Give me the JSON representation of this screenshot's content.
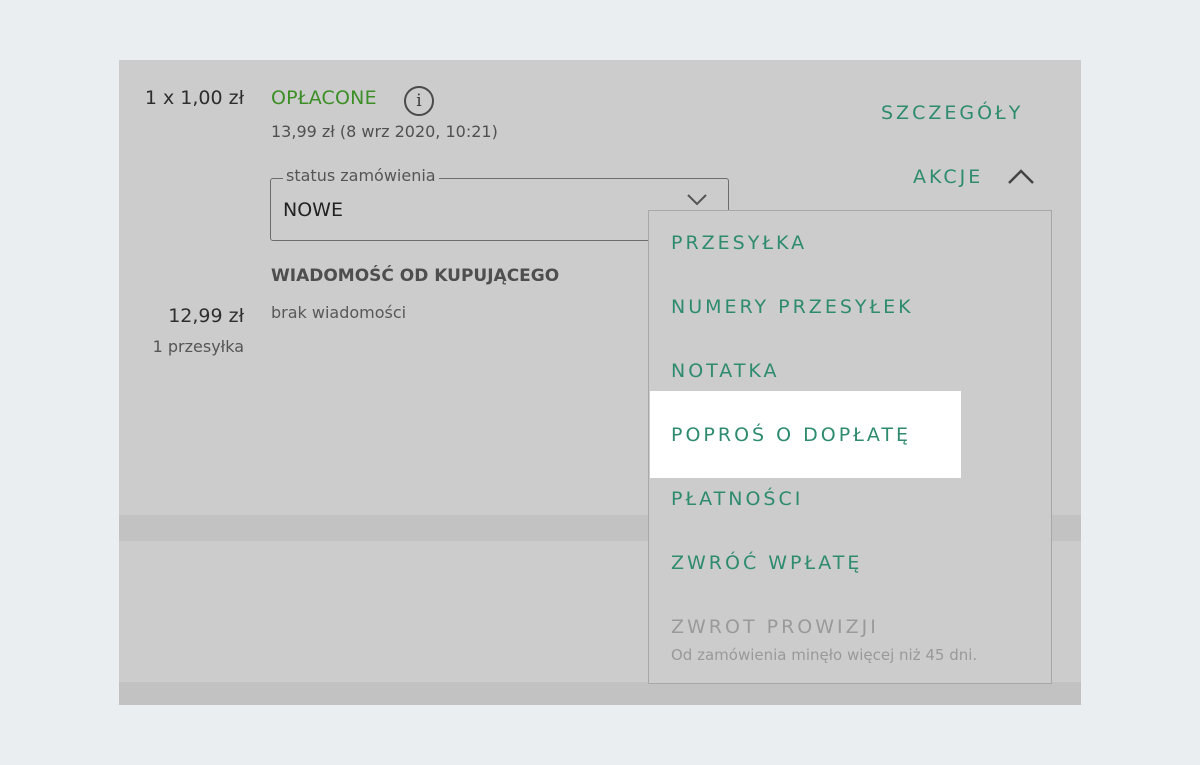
{
  "order": {
    "quantity_price": "1 x 1,00 zł",
    "total_price": "12,99 zł",
    "shipments": "1 przesyłka"
  },
  "payment": {
    "status": "OPŁACONE",
    "amount_date": "13,99 zł  (8 wrz 2020, 10:21)"
  },
  "order_status": {
    "legend": "status zamówienia",
    "value": "NOWE"
  },
  "message": {
    "title": "WIADOMOŚĆ OD KUPUJĄCEGO",
    "body": "brak wiadomości"
  },
  "links": {
    "details": "SZCZEGÓŁY",
    "actions": "AKCJE"
  },
  "actions_menu": {
    "items": [
      {
        "label": "PRZESYŁKA"
      },
      {
        "label": "NUMERY PRZESYŁEK"
      },
      {
        "label": "NOTATKA"
      },
      {
        "label": "POPROŚ O DOPŁATĘ"
      },
      {
        "label": "PŁATNOŚCI"
      },
      {
        "label": "ZWRÓĆ WPŁATĘ"
      },
      {
        "label": "ZWROT PROWIZJI",
        "note": "Od zamówienia minęło więcej niż 45 dni."
      }
    ]
  },
  "colors": {
    "accent": "#2e8b6e",
    "paid_status": "#3c8f26",
    "panel": "#cccccc",
    "page_bg": "#eaeef1",
    "highlight": "#ffffff"
  }
}
